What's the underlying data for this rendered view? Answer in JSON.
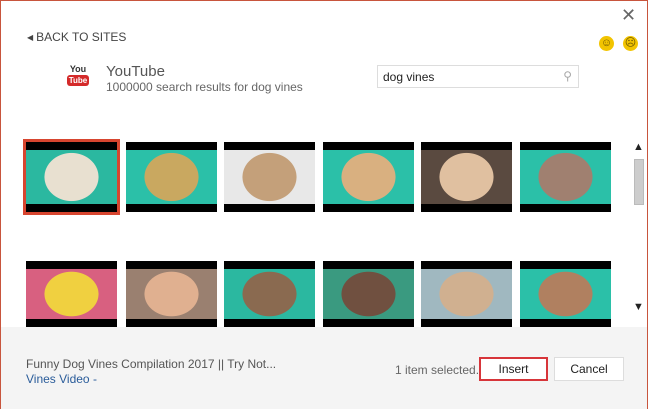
{
  "header": {
    "back_label": "BACK TO SITES",
    "close_icon": "close-icon",
    "feedback": [
      "smile-icon",
      "frown-icon"
    ]
  },
  "site": {
    "logo_top": "You",
    "logo_bottom": "Tube",
    "name": "YouTube",
    "results": "1000000 search results for dog vines"
  },
  "search": {
    "value": "dog vines",
    "icon": "search-icon"
  },
  "thumbnails": [
    {
      "bg": "#2bb8a0",
      "fg": "#e8e0d0",
      "selected": true
    },
    {
      "bg": "#2bc0a8",
      "fg": "#c9a860"
    },
    {
      "bg": "#e8e8e8",
      "fg": "#c4a07a"
    },
    {
      "bg": "#2bc0a8",
      "fg": "#d9b080"
    },
    {
      "bg": "#5a4a40",
      "fg": "#e0c0a0"
    },
    {
      "bg": "#2bc0a8",
      "fg": "#a08070"
    },
    {
      "bg": "#d86080",
      "fg": "#f0d040"
    },
    {
      "bg": "#9a8070",
      "fg": "#e0b090"
    },
    {
      "bg": "#2bb8a0",
      "fg": "#8a6a50"
    },
    {
      "bg": "#3a9a80",
      "fg": "#705040"
    },
    {
      "bg": "#a0b8c0",
      "fg": "#d0b090"
    },
    {
      "bg": "#2bc0a8",
      "fg": "#b08060"
    }
  ],
  "footer": {
    "title": "Funny Dog Vines Compilation 2017 || Try Not...",
    "link": "Vines Video -",
    "selection": "1 item selected.",
    "insert": "Insert",
    "cancel": "Cancel"
  }
}
